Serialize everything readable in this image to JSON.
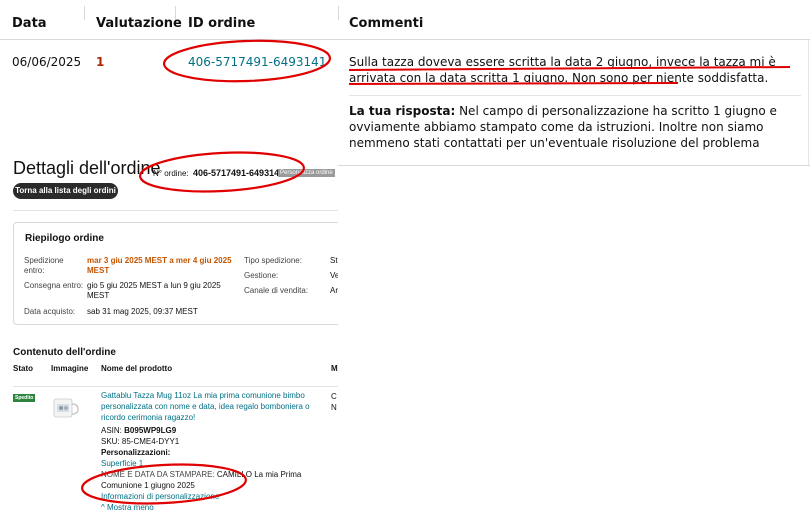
{
  "feedback": {
    "headers": {
      "date": "Data",
      "rating": "Valutazione",
      "order_id": "ID ordine",
      "comments": "Commenti"
    },
    "row": {
      "date": "06/06/2025",
      "rating": "1",
      "order_id": "406-5717491-6493141",
      "comment": "Sulla tazza doveva essere scritta la data 2 giugno, invece la tazza mi è arrivata con la data scritta 1 giugno. Non sono per niente soddisfatta.",
      "reply_label": "La tua risposta:",
      "reply_text": " Nel campo di personalizzazione ha scritto 1 giugno e ovviamente abbiamo stampato come da istruzioni. Inoltre non siamo nemmeno stati contattati per un'eventuale risoluzione del problema"
    }
  },
  "order_details": {
    "title": "Dettagli dell'ordine",
    "order_number_label": "N° ordine:",
    "order_number": "406-5717491-6493141",
    "badge": "Personalizza ordine",
    "back_button": "Torna alla lista degli ordini",
    "summary": {
      "title": "Riepilogo ordine",
      "shipping_label_1": "Spedizione",
      "shipping_label_2": "entro:",
      "shipping_value_1": "mar 3 giu 2025 MEST a mer 4 giu 2025",
      "shipping_value_2": "MEST",
      "delivery_label": "Consegna entro:",
      "delivery_value_1": "gio 5 giu 2025 MEST a lun 9 giu 2025",
      "delivery_value_2": "MEST",
      "purchase_label": "Data acquisto:",
      "purchase_value": "sab 31 mag 2025, 09:37 MEST",
      "ship_type_label": "Tipo spedizione:",
      "ship_type_value": "St",
      "management_label": "Gestione:",
      "management_value": "Ve",
      "channel_label": "Canale di vendita:",
      "channel_value": "An"
    },
    "contents": {
      "title": "Contenuto dell'ordine",
      "headers": {
        "status": "Stato",
        "image": "Immagine",
        "product_name": "Nome del prodotto",
        "more": "M"
      },
      "status_badge": "Spedito",
      "product": {
        "name_line_1": "Gattablu Tazza Mug 11oz La mia prima comunione bimbo",
        "name_line_2": "personalizzata con nome e data, idea regalo bomboniera o",
        "name_line_3": "ricordo cerimonia ragazzo!",
        "asin_label": "ASIN:",
        "asin": "B095WP9LG9",
        "sku_label": "SKU:",
        "sku": "85-CME4-DYY1",
        "personalization_label": "Personalizzazioni:",
        "surface": "Superficie 1",
        "field_label": "NOME E DATA DA STAMPARE:",
        "field_value_1": "CAMILLO La mia Prima",
        "field_value_2": "Comunione 1 giugno 2025",
        "info_link": "Informazioni di personalizzazione",
        "show_menu": "^ Mostra meno",
        "col_m_1": "C",
        "col_m_2": "N"
      }
    }
  },
  "colors": {
    "annotation": "#e00000",
    "link": "#007185",
    "rating": "#b12704",
    "orange": "#c45500",
    "shipped_badge": "#2e8540"
  }
}
